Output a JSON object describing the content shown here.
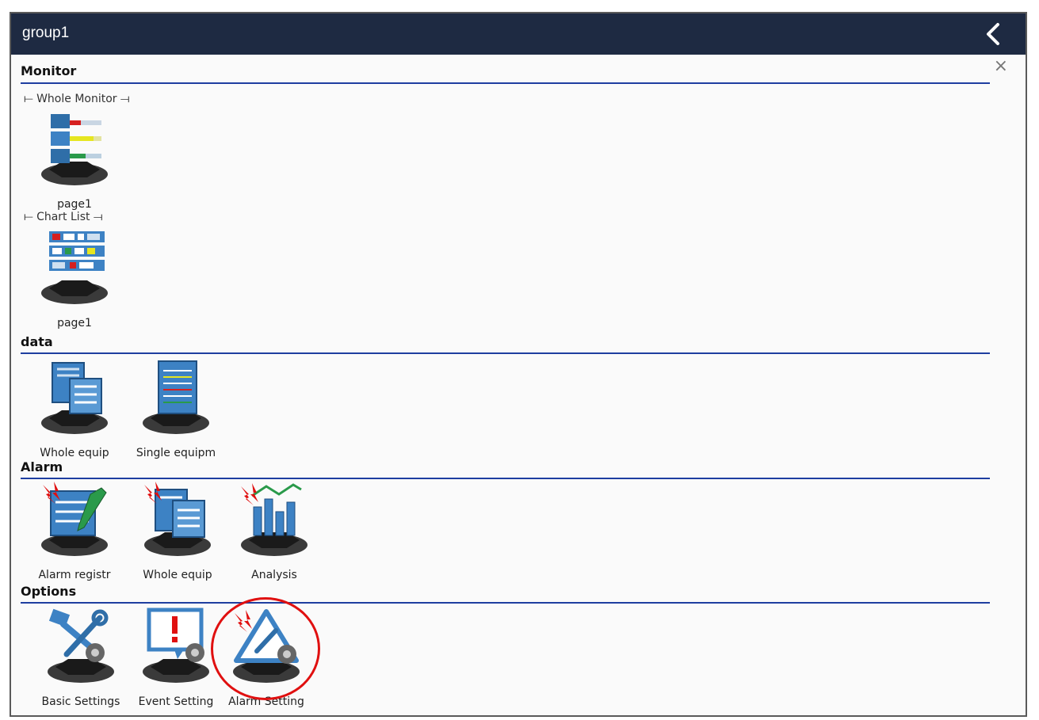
{
  "window": {
    "title": "group1"
  },
  "sections": {
    "monitor": {
      "title": "Monitor",
      "whole_monitor": {
        "heading": "Whole Monitor",
        "items": [
          {
            "label": "page1",
            "icon": "whole-monitor-page-icon"
          }
        ]
      },
      "chart_list": {
        "heading": "Chart List",
        "items": [
          {
            "label": "page1",
            "icon": "chart-list-page-icon"
          }
        ]
      }
    },
    "data": {
      "title": "data",
      "items": [
        {
          "label": "Whole equip",
          "icon": "whole-equipment-data-icon"
        },
        {
          "label": "Single equipm",
          "icon": "single-equipment-data-icon"
        }
      ]
    },
    "alarm": {
      "title": "Alarm",
      "items": [
        {
          "label": "Alarm registr",
          "icon": "alarm-registration-icon"
        },
        {
          "label": "Whole equip",
          "icon": "whole-equipment-alarm-icon"
        },
        {
          "label": "Analysis",
          "icon": "alarm-analysis-icon"
        }
      ]
    },
    "options": {
      "title": "Options",
      "items": [
        {
          "label": "Basic Settings",
          "icon": "basic-settings-icon"
        },
        {
          "label": "Event Setting",
          "icon": "event-setting-icon"
        },
        {
          "label": "Alarm Setting",
          "icon": "alarm-setting-icon"
        }
      ]
    }
  },
  "colors": {
    "titlebar": "#1e2a42",
    "rule": "#1e3ea0",
    "highlight": "#e01010",
    "icon_blue": "#3d82c4"
  }
}
